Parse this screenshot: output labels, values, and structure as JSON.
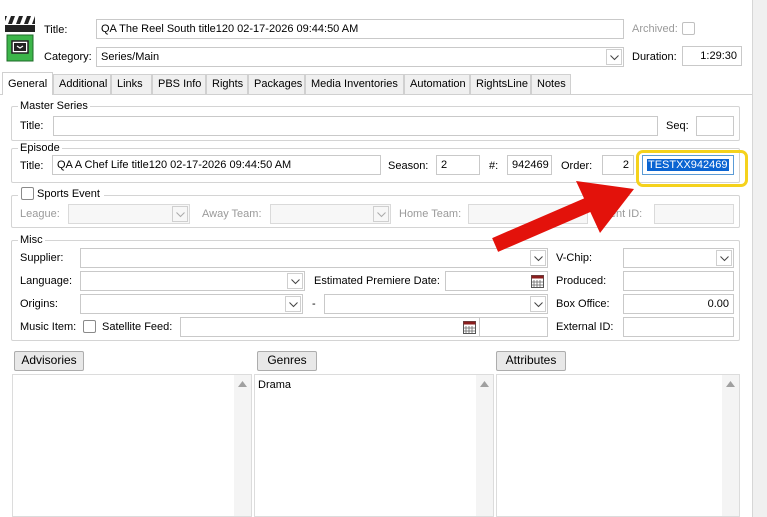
{
  "header": {
    "title_label": "Title:",
    "title_value": "QA The Reel South title120 02-17-2026 09:44:50 AM",
    "archived_label": "Archived:",
    "category_label": "Category:",
    "category_value": "Series/Main",
    "duration_label": "Duration:",
    "duration_value": "1:29:30",
    "app_icon": "clapperboard-tv-icon"
  },
  "tabs": [
    "General",
    "Additional",
    "Links",
    "PBS Info",
    "Rights",
    "Packages",
    "Media Inventories",
    "Automation",
    "RightsLine",
    "Notes"
  ],
  "master_series": {
    "group_label": "Master Series",
    "title_label": "Title:",
    "title_value": "",
    "seq_label": "Seq:",
    "seq_value": ""
  },
  "episode": {
    "group_label": "Episode",
    "title_label": "Title:",
    "title_value": "QA A Chef Life title120 02-17-2026 09:44:50 AM",
    "season_label": "Season:",
    "season_value": "2",
    "number_label": "#:",
    "number_value": "942469",
    "order_label": "Order:",
    "order_value": "2",
    "code_value": "TESTXX942469"
  },
  "sports": {
    "checkbox_label": "Sports Event",
    "league_label": "League:",
    "away_label": "Away Team:",
    "home_label": "Home Team:",
    "event_id_label": "Event ID:"
  },
  "misc": {
    "group_label": "Misc",
    "supplier_label": "Supplier:",
    "vchip_label": "V-Chip:",
    "language_label": "Language:",
    "premiere_label": "Estimated Premiere Date:",
    "produced_label": "Produced:",
    "origins_label": "Origins:",
    "origins_sep": "-",
    "box_office_label": "Box Office:",
    "box_office_value": "0.00",
    "music_item_label": "Music Item:",
    "satellite_label": "Satellite Feed:",
    "external_id_label": "External ID:"
  },
  "lists": {
    "advisories_label": "Advisories",
    "genres_label": "Genres",
    "genres_items": [
      "Drama"
    ],
    "attributes_label": "Attributes"
  },
  "annotation": {
    "arrow_color": "#e3120b",
    "highlight_color": "#f5d21c"
  }
}
